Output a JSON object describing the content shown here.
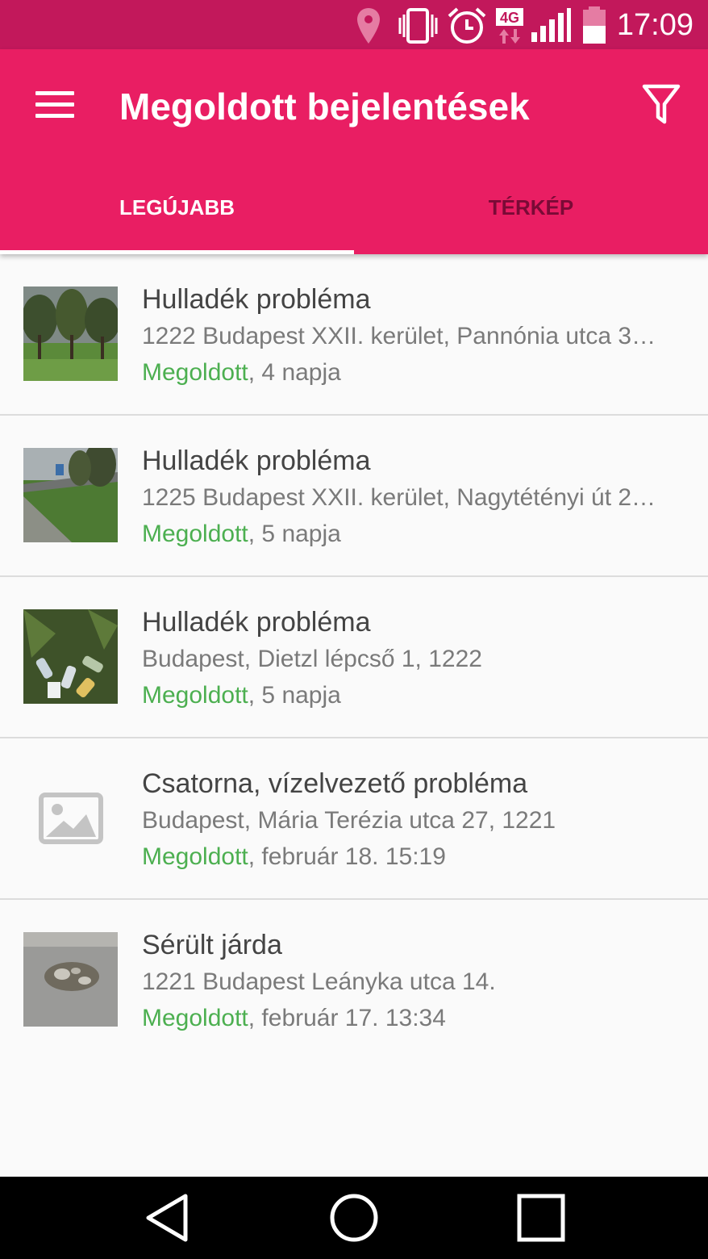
{
  "status_bar": {
    "time": "17:09",
    "network": "4G",
    "icons": [
      "location-icon",
      "vibrate-icon",
      "alarm-icon",
      "network-4g-icon",
      "signal-icon",
      "battery-icon"
    ]
  },
  "app_bar": {
    "title": "Megoldott bejelentések",
    "menu_icon": "hamburger-menu-icon",
    "filter_icon": "filter-icon"
  },
  "tabs": [
    {
      "label": "LEGÚJABB",
      "selected": true
    },
    {
      "label": "TÉRKÉP",
      "selected": false
    }
  ],
  "items": [
    {
      "title": "Hulladék probléma",
      "address": "1222 Budapest XXII. kerület, Pannónia utca 3…",
      "status": "Megoldott",
      "time": ", 4 napja",
      "image": "photo-park-trees"
    },
    {
      "title": "Hulladék probléma",
      "address": "1225 Budapest XXII. kerület, Nagytétényi út 2…",
      "status": "Megoldott",
      "time": ", 5 napja",
      "image": "photo-roadside-ditch"
    },
    {
      "title": "Hulladék probléma",
      "address": "Budapest, Dietzl lépcső 1, 1222",
      "status": "Megoldott",
      "time": ", 5 napja",
      "image": "photo-litter-bottles"
    },
    {
      "title": "Csatorna, vízelvezető probléma",
      "address": "Budapest, Mária Terézia utca 27, 1221",
      "status": "Megoldott",
      "time": ", február 18. 15:19",
      "image": "image-placeholder-icon"
    },
    {
      "title": "Sérült járda",
      "address": "1221 Budapest Leányka utca 14.",
      "status": "Megoldott",
      "time": ", február 17. 13:34",
      "image": "photo-damaged-pavement"
    }
  ],
  "colors": {
    "status_bar": "#c2185b",
    "app_bar": "#e91e63",
    "solved_green": "#4caf50",
    "inactive_tab": "#7a0a36"
  },
  "nav_bar": {
    "icons": [
      "back-icon",
      "home-icon",
      "recents-icon"
    ]
  }
}
